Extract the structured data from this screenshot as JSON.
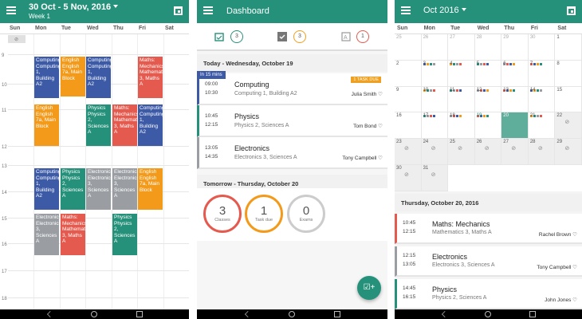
{
  "colors": {
    "primary": "#26917a",
    "blue": "#3c5aa6",
    "orange": "#f39a1a",
    "green": "#26917a",
    "red": "#e55a4e",
    "grey": "#9a9ea3"
  },
  "panel1": {
    "title": "30 Oct - 5 Nov, 2016",
    "subtitle": "Week 1",
    "days": [
      "Sun",
      "Mon",
      "Tue",
      "Wed",
      "Thu",
      "Fri",
      "Sat"
    ],
    "hours": [
      "9",
      "10",
      "11",
      "12",
      "13",
      "14",
      "15",
      "16",
      "17",
      "18"
    ],
    "events": [
      {
        "text": "Computing Computing 1, Building A2",
        "color": "blue"
      },
      {
        "text": "English English 7a, Main Block",
        "color": "orange"
      },
      {
        "text": "Computing Computing 1, Building A2",
        "color": "blue"
      },
      {
        "text": "Maths: Mechanics Mathematics 3, Maths A",
        "color": "red"
      },
      {
        "text": "English English 7a, Main Block",
        "color": "orange"
      },
      {
        "text": "Physics Physics 2, Sciences A",
        "color": "green"
      },
      {
        "text": "Maths: Mechanics Mathematics 3, Maths A",
        "color": "red"
      },
      {
        "text": "Computing Computing 1, Building A2",
        "color": "blue"
      },
      {
        "text": "Computing Computing 1, Building A2",
        "color": "blue"
      },
      {
        "text": "Physics Physics 2, Sciences A",
        "color": "green"
      },
      {
        "text": "Electronics Electronics 3, Sciences A",
        "color": "grey"
      },
      {
        "text": "Electronics Electronics 3, Sciences A",
        "color": "grey"
      },
      {
        "text": "English English 7a, Main Block",
        "color": "orange"
      },
      {
        "text": "Electronics Electronics 3, Sciences A",
        "color": "grey"
      },
      {
        "text": "Maths: Mechanics Mathematics 3, Maths A",
        "color": "red"
      },
      {
        "text": "Physics Physics 2, Sciences A",
        "color": "green"
      }
    ]
  },
  "panel2": {
    "title": "Dashboard",
    "summary": {
      "classes_count": "3",
      "tasks_count": "3",
      "exams_count": "1"
    },
    "today_header": "Today - Wednesday, October 19",
    "in_badge": "In 15 mins",
    "today": [
      {
        "start": "09:00",
        "end": "10:30",
        "subject": "Computing",
        "location": "Computing 1, Building A2",
        "teacher": "Julia Smith",
        "badge": "1 TASK DUE",
        "color": "blue"
      },
      {
        "start": "10:45",
        "end": "12:15",
        "subject": "Physics",
        "location": "Physics 2, Sciences A",
        "teacher": "Tom Bond",
        "badge": "",
        "color": "green"
      },
      {
        "start": "13:05",
        "end": "14:35",
        "subject": "Electronics",
        "location": "Electronics 3, Sciences A",
        "teacher": "Tony Campbell",
        "badge": "",
        "color": "grey"
      }
    ],
    "tomorrow_header": "Tomorrow - Thursday, October 20",
    "tomorrow_summary": [
      {
        "value": "3",
        "label": "Classes",
        "color": "red"
      },
      {
        "value": "1",
        "label": "Task due",
        "color": "orange"
      },
      {
        "value": "0",
        "label": "Exams",
        "color": "#cccccc"
      }
    ],
    "fab_icon": "add-task-icon"
  },
  "panel3": {
    "title": "Oct 2016",
    "days": [
      "Sun",
      "Mon",
      "Tue",
      "Wed",
      "Thu",
      "Fri",
      "Sat"
    ],
    "weeks": [
      [
        "25",
        "26",
        "27",
        "28",
        "29",
        "30",
        "1"
      ],
      [
        "2",
        "3",
        "4",
        "5",
        "6",
        "7",
        "8"
      ],
      [
        "9",
        "10",
        "11",
        "12",
        "13",
        "14",
        "15"
      ],
      [
        "16",
        "17",
        "18",
        "19",
        "20",
        "21",
        "22"
      ],
      [
        "23",
        "24",
        "25",
        "26",
        "27",
        "28",
        "29"
      ],
      [
        "30",
        "31",
        "",
        "",
        "",
        "",
        ""
      ]
    ],
    "selected_header": "Thursday, October 20, 2016",
    "classes": [
      {
        "start": "10:45",
        "end": "12:15",
        "subject": "Maths: Mechanics",
        "location": "Mathematics 3, Maths A",
        "teacher": "Rachel Brown",
        "color": "red"
      },
      {
        "start": "12:15",
        "end": "13:05",
        "subject": "Electronics",
        "location": "Electronics 3, Sciences A",
        "teacher": "Tony Campbell",
        "color": "grey"
      },
      {
        "start": "14:45",
        "end": "16:15",
        "subject": "Physics",
        "location": "Physics 2, Sciences A",
        "teacher": "John Jones",
        "color": "green"
      }
    ]
  }
}
